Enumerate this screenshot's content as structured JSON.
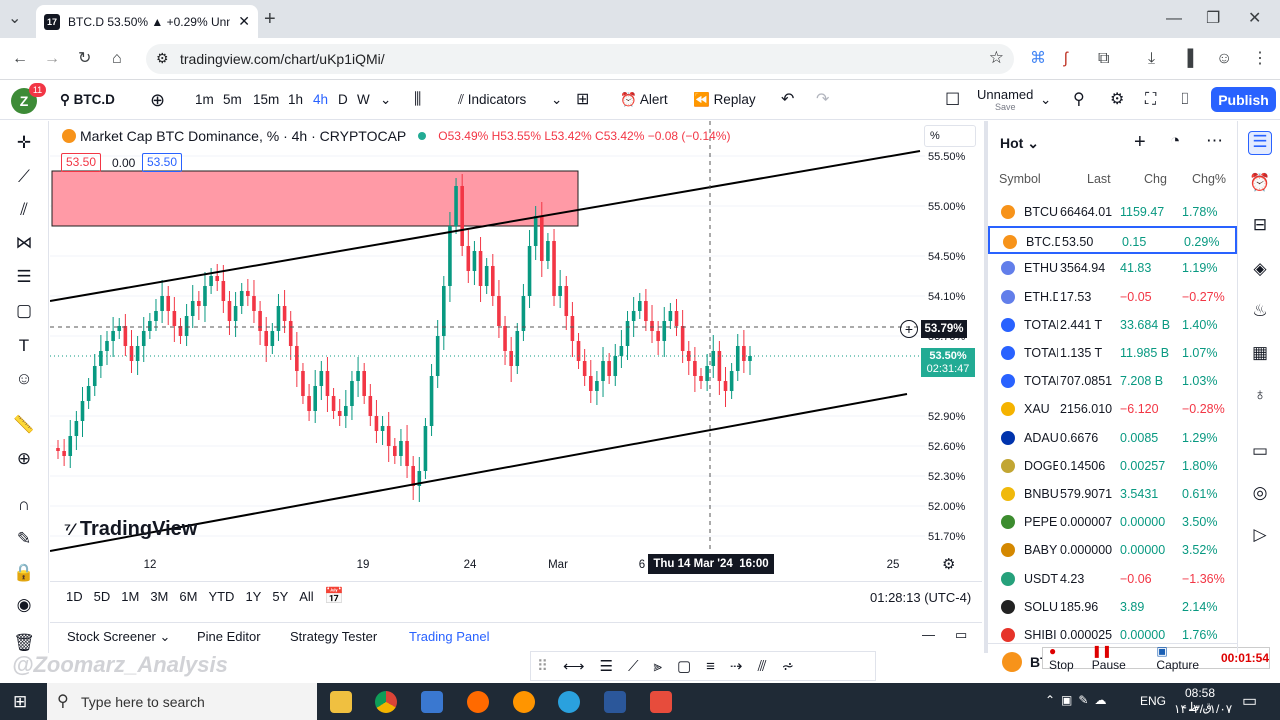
{
  "browser": {
    "tab_title": "BTC.D 53.50% ▲ +0.29% Unnam",
    "url": "tradingview.com/chart/uKp1iQMi/"
  },
  "toolbar": {
    "symbol": "BTC.D",
    "intervals": [
      "1m",
      "5m",
      "15m",
      "1h",
      "4h",
      "D",
      "W"
    ],
    "indicators": "Indicators",
    "alert": "Alert",
    "replay": "Replay",
    "layout_name": "Unnamed",
    "layout_status": "Save",
    "publish": "Publish",
    "badge": "11",
    "avatar": "Z"
  },
  "legend": {
    "title": "Market Cap BTC Dominance, % · 4h · CRYPTOCAP",
    "ohlc": "O53.49% H53.55% L53.42% C53.42% −0.08 (−0.14%)",
    "bid": "53.50",
    "spread": "0.00",
    "ask": "53.50"
  },
  "price_axis": {
    "unit": "%",
    "ticks": [
      "55.50%",
      "55.00%",
      "54.50%",
      "54.10%",
      "53.70%",
      "52.90%",
      "52.60%",
      "52.30%",
      "52.00%",
      "51.70%"
    ],
    "crosshair_price": "53.79%",
    "last_price": "53.50%",
    "countdown": "02:31:47"
  },
  "time_axis": {
    "ticks": [
      "12",
      "19",
      "24",
      "Mar",
      "6",
      "1",
      "25"
    ],
    "crosshair_time": "Thu 14 Mar '24  16:00"
  },
  "watermark": "TradingView",
  "ranges": [
    "1D",
    "5D",
    "1M",
    "3M",
    "6M",
    "YTD",
    "1Y",
    "5Y",
    "All"
  ],
  "clock": "01:28:13 (UTC-4)",
  "bottom_tabs": [
    "Stock Screener",
    "Pine Editor",
    "Strategy Tester",
    "Trading Panel"
  ],
  "overlay_text": "@Zoomarz_Analysis",
  "recorder": {
    "stop": "Stop",
    "pause": "Pause",
    "capture": "Capture",
    "time": "00:01:54"
  },
  "watchlist": {
    "title": "Hot",
    "headers": [
      "Symbol",
      "Last",
      "Chg",
      "Chg%"
    ],
    "rows": [
      {
        "sym": "BTCU",
        "last": "66464.01",
        "chg": "1159.47",
        "pct": "1.78%",
        "up": true,
        "color": "#f7931a"
      },
      {
        "sym": "BTC.D",
        "last": "53.50",
        "chg": "0.15",
        "pct": "0.29%",
        "up": true,
        "color": "#f7931a"
      },
      {
        "sym": "ETHU",
        "last": "3564.94",
        "chg": "41.83",
        "pct": "1.19%",
        "up": true,
        "color": "#627eea"
      },
      {
        "sym": "ETH.D",
        "last": "17.53",
        "chg": "−0.05",
        "pct": "−0.27%",
        "up": false,
        "color": "#627eea"
      },
      {
        "sym": "TOTAI",
        "last": "2.441 T",
        "chg": "33.684 B",
        "pct": "1.40%",
        "up": true,
        "color": "#2962ff"
      },
      {
        "sym": "TOTAI",
        "last": "1.135 T",
        "chg": "11.985 B",
        "pct": "1.07%",
        "up": true,
        "color": "#2962ff"
      },
      {
        "sym": "TOTAI",
        "last": "707.0851",
        "chg": "7.208 B",
        "pct": "1.03%",
        "up": true,
        "color": "#2962ff"
      },
      {
        "sym": "XAU",
        "last": "2156.010",
        "chg": "−6.120",
        "pct": "−0.28%",
        "up": false,
        "color": "#f5b300"
      },
      {
        "sym": "ADAU",
        "last": "0.6676",
        "chg": "0.0085",
        "pct": "1.29%",
        "up": true,
        "color": "#0033ad"
      },
      {
        "sym": "DOGE",
        "last": "0.14506",
        "chg": "0.00257",
        "pct": "1.80%",
        "up": true,
        "color": "#c2a633"
      },
      {
        "sym": "BNBU",
        "last": "579.9071",
        "chg": "3.5431",
        "pct": "0.61%",
        "up": true,
        "color": "#f0b90b"
      },
      {
        "sym": "PEPE",
        "last": "0.000007",
        "chg": "0.00000",
        "pct": "3.50%",
        "up": true,
        "color": "#3c8c2f"
      },
      {
        "sym": "BABYI",
        "last": "0.000000",
        "chg": "0.00000",
        "pct": "3.52%",
        "up": true,
        "color": "#d48800"
      },
      {
        "sym": "USDT",
        "last": "4.23",
        "chg": "−0.06",
        "pct": "−1.36%",
        "up": false,
        "color": "#26a17b"
      },
      {
        "sym": "SOLU",
        "last": "185.96",
        "chg": "3.89",
        "pct": "2.14%",
        "up": true,
        "color": "#222"
      },
      {
        "sym": "SHIBI",
        "last": "0.000025",
        "chg": "0.00000",
        "pct": "1.76%",
        "up": true,
        "color": "#e6342a"
      }
    ],
    "footer_sym": "BTC"
  },
  "taskbar": {
    "search": "Type here to search",
    "lang": "ENG",
    "time": "08:58 ق.ظ",
    "date": "۱۴۰۳/۰۱/۰۷"
  },
  "chart_data": {
    "type": "candlestick",
    "title": "Market Cap BTC Dominance, % · 4h · CRYPTOCAP",
    "ylabel": "%",
    "ylim": [
      51.55,
      55.75
    ],
    "x_ticks": [
      "12",
      "19",
      "24",
      "Mar",
      "6",
      "1",
      "25"
    ],
    "y_ticks": [
      55.5,
      55.0,
      54.5,
      54.1,
      53.7,
      52.9,
      52.6,
      52.3,
      52.0,
      51.7
    ],
    "last": 53.5,
    "crosshair": {
      "price": 53.79,
      "time": "Thu 14 Mar '24 16:00"
    },
    "closes": [
      52.55,
      52.5,
      52.7,
      52.85,
      53.05,
      53.2,
      53.4,
      53.55,
      53.65,
      53.75,
      53.8,
      53.6,
      53.45,
      53.6,
      53.75,
      53.85,
      53.95,
      54.1,
      53.95,
      53.8,
      53.7,
      53.9,
      54.05,
      54.0,
      54.2,
      54.3,
      54.25,
      54.05,
      53.85,
      54.0,
      54.15,
      54.1,
      53.95,
      53.75,
      53.6,
      53.75,
      54.0,
      53.85,
      53.6,
      53.35,
      53.1,
      52.95,
      53.2,
      53.35,
      53.1,
      52.95,
      52.9,
      53.0,
      53.25,
      53.35,
      53.1,
      52.9,
      52.75,
      52.8,
      52.6,
      52.5,
      52.65,
      52.4,
      52.2,
      52.35,
      52.8,
      53.3,
      53.7,
      54.2,
      54.8,
      55.2,
      54.6,
      54.35,
      54.55,
      54.2,
      54.4,
      54.1,
      53.8,
      53.55,
      53.4,
      53.75,
      54.1,
      54.6,
      54.9,
      54.45,
      54.65,
      54.1,
      54.2,
      53.9,
      53.65,
      53.45,
      53.3,
      53.15,
      53.25,
      53.45,
      53.3,
      53.5,
      53.6,
      53.85,
      53.95,
      54.05,
      53.85,
      53.75,
      53.65,
      53.85,
      53.95,
      53.8,
      53.55,
      53.45,
      53.3,
      53.25,
      53.4,
      53.55,
      53.25,
      53.15,
      53.35,
      53.6,
      53.45,
      53.5
    ]
  },
  "zone": {
    "top": 55.35,
    "bottom": 54.8
  }
}
